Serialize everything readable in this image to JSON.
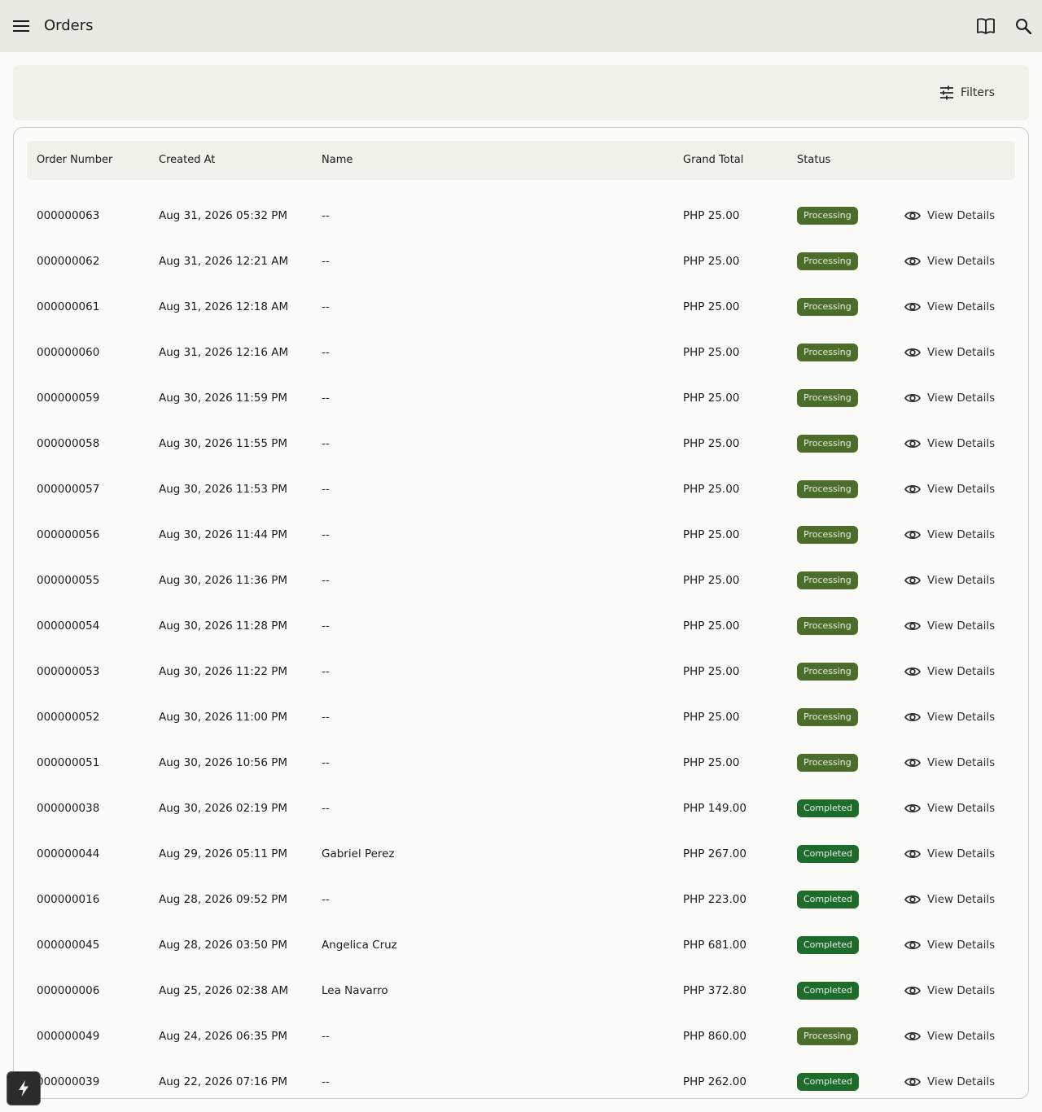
{
  "header": {
    "title": "Orders",
    "icons": [
      "menu-icon",
      "book-icon",
      "search-icon"
    ]
  },
  "filters": {
    "label": "Filters",
    "icon": "tune-icon"
  },
  "table": {
    "columns": [
      "Order Number",
      "Created At",
      "Name",
      "Grand Total",
      "Status"
    ],
    "action_label": "View Details",
    "rows": [
      {
        "order": "000000063",
        "created": "Aug 31, 2026 05:32 PM",
        "name": "--",
        "total": "PHP 25.00",
        "status": "Processing"
      },
      {
        "order": "000000062",
        "created": "Aug 31, 2026 12:21 AM",
        "name": "--",
        "total": "PHP 25.00",
        "status": "Processing"
      },
      {
        "order": "000000061",
        "created": "Aug 31, 2026 12:18 AM",
        "name": "--",
        "total": "PHP 25.00",
        "status": "Processing"
      },
      {
        "order": "000000060",
        "created": "Aug 31, 2026 12:16 AM",
        "name": "--",
        "total": "PHP 25.00",
        "status": "Processing"
      },
      {
        "order": "000000059",
        "created": "Aug 30, 2026 11:59 PM",
        "name": "--",
        "total": "PHP 25.00",
        "status": "Processing"
      },
      {
        "order": "000000058",
        "created": "Aug 30, 2026 11:55 PM",
        "name": "--",
        "total": "PHP 25.00",
        "status": "Processing"
      },
      {
        "order": "000000057",
        "created": "Aug 30, 2026 11:53 PM",
        "name": "--",
        "total": "PHP 25.00",
        "status": "Processing"
      },
      {
        "order": "000000056",
        "created": "Aug 30, 2026 11:44 PM",
        "name": "--",
        "total": "PHP 25.00",
        "status": "Processing"
      },
      {
        "order": "000000055",
        "created": "Aug 30, 2026 11:36 PM",
        "name": "--",
        "total": "PHP 25.00",
        "status": "Processing"
      },
      {
        "order": "000000054",
        "created": "Aug 30, 2026 11:28 PM",
        "name": "--",
        "total": "PHP 25.00",
        "status": "Processing"
      },
      {
        "order": "000000053",
        "created": "Aug 30, 2026 11:22 PM",
        "name": "--",
        "total": "PHP 25.00",
        "status": "Processing"
      },
      {
        "order": "000000052",
        "created": "Aug 30, 2026 11:00 PM",
        "name": "--",
        "total": "PHP 25.00",
        "status": "Processing"
      },
      {
        "order": "000000051",
        "created": "Aug 30, 2026 10:56 PM",
        "name": "--",
        "total": "PHP 25.00",
        "status": "Processing"
      },
      {
        "order": "000000038",
        "created": "Aug 30, 2026 02:19 PM",
        "name": "--",
        "total": "PHP 149.00",
        "status": "Completed"
      },
      {
        "order": "000000044",
        "created": "Aug 29, 2026 05:11 PM",
        "name": "Gabriel Perez",
        "total": "PHP 267.00",
        "status": "Completed"
      },
      {
        "order": "000000016",
        "created": "Aug 28, 2026 09:52 PM",
        "name": "--",
        "total": "PHP 223.00",
        "status": "Completed"
      },
      {
        "order": "000000045",
        "created": "Aug 28, 2026 03:50 PM",
        "name": "Angelica Cruz",
        "total": "PHP 681.00",
        "status": "Completed"
      },
      {
        "order": "000000006",
        "created": "Aug 25, 2026 02:38 AM",
        "name": "Lea Navarro",
        "total": "PHP 372.80",
        "status": "Completed"
      },
      {
        "order": "000000049",
        "created": "Aug 24, 2026 06:35 PM",
        "name": "--",
        "total": "PHP 860.00",
        "status": "Processing"
      },
      {
        "order": "000000039",
        "created": "Aug 22, 2026 07:16 PM",
        "name": "--",
        "total": "PHP 262.00",
        "status": "Completed"
      }
    ]
  },
  "colors": {
    "topbar_bg": "#e7ece2",
    "processing_badge": "#4b6c2a",
    "completed_badge": "#1f6b2c"
  },
  "fab": {
    "icon": "bolt-icon"
  }
}
